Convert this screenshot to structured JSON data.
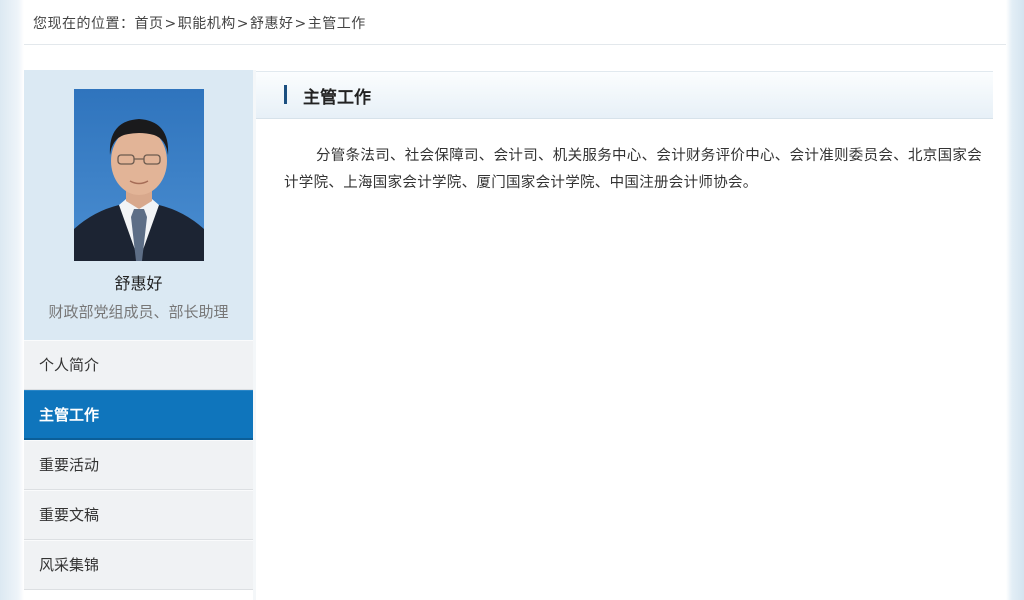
{
  "breadcrumb": {
    "prefix": "您现在的位置：",
    "items": [
      "首页",
      "职能机构",
      "舒惠好",
      "主管工作"
    ],
    "separator": ">"
  },
  "profile": {
    "name": "舒惠好",
    "title": "财政部党组成员、部长助理"
  },
  "nav": {
    "items": [
      {
        "label": "个人简介"
      },
      {
        "label": "主管工作"
      },
      {
        "label": "重要活动"
      },
      {
        "label": "重要文稿"
      },
      {
        "label": "风采集锦"
      }
    ],
    "active_index": 1
  },
  "content": {
    "heading": "主管工作",
    "body": "分管条法司、社会保障司、会计司、机关服务中心、会计财务评价中心、会计准则委员会、北京国家会计学院、上海国家会计学院、厦门国家会计学院、中国注册会计师协会。"
  },
  "colors": {
    "accent": "#0f75bc",
    "header_bar": "#1b4f80",
    "profile_bg": "#dbe9f3"
  }
}
